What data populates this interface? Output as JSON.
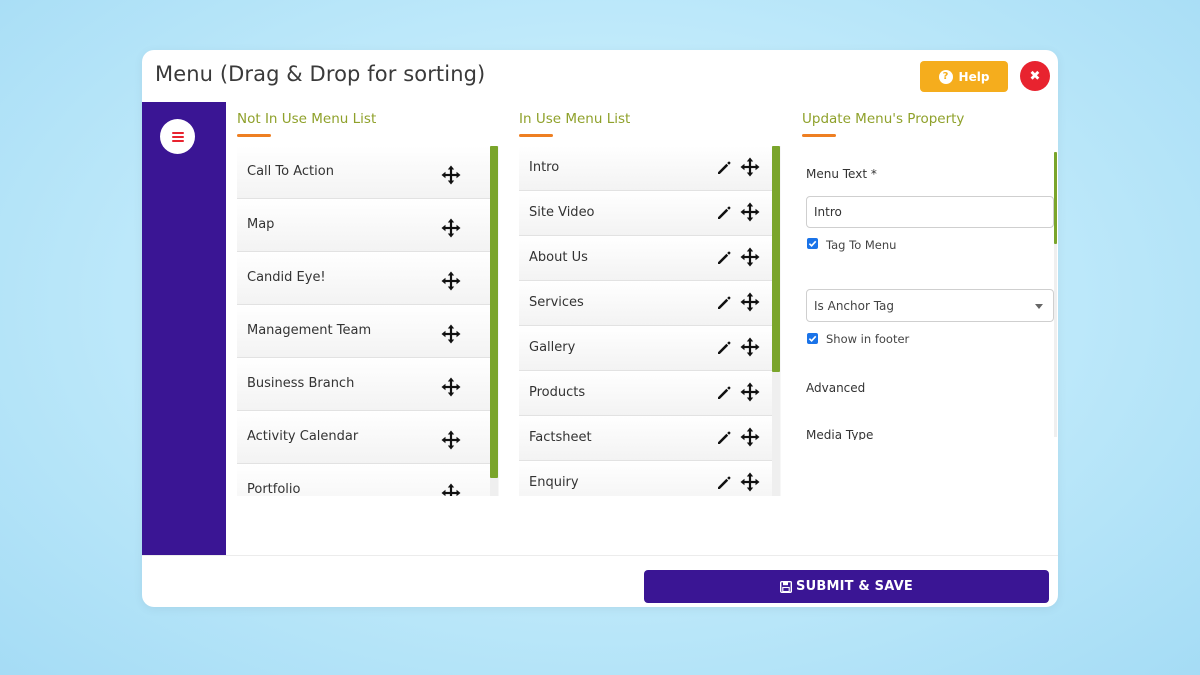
{
  "window": {
    "title": "Menu (Drag & Drop for sorting)",
    "help_label": "Help",
    "close_glyph": "✖"
  },
  "columns": {
    "not_in_use": {
      "heading": "Not In Use Menu List",
      "items": [
        "Call To Action",
        "Map",
        "Candid Eye!",
        "Management Team",
        "Business Branch",
        "Activity Calendar",
        "Portfolio"
      ]
    },
    "in_use": {
      "heading": "In Use Menu List",
      "items": [
        "Intro",
        "Site Video",
        "About Us",
        "Services",
        "Gallery",
        "Products",
        "Factsheet",
        "Enquiry"
      ]
    },
    "properties": {
      "heading": "Update Menu's Property",
      "menu_text_label": "Menu Text *",
      "menu_text_value": "Intro",
      "tag_to_menu_label": "Tag To Menu",
      "tag_to_menu_checked": true,
      "anchor_select_value": "Is Anchor Tag",
      "show_in_footer_label": "Show in footer",
      "show_in_footer_checked": true,
      "advanced_label": "Advanced",
      "media_type_label": "Media Type"
    }
  },
  "footer": {
    "submit_label": "SUBMIT & SAVE"
  },
  "colors": {
    "sidebar": "#3a1594",
    "accent_green": "#8fa12b",
    "underline_orange": "#ee7f22",
    "help_yellow": "#f5ad1d",
    "close_red": "#e8232f",
    "scrollbar_green": "#7aa52b"
  },
  "icons": {
    "move": "move-arrows-icon",
    "edit": "pencil-icon",
    "help": "question-circle-icon",
    "save": "floppy-disk-icon",
    "menu": "hamburger-icon",
    "close": "close-icon"
  }
}
